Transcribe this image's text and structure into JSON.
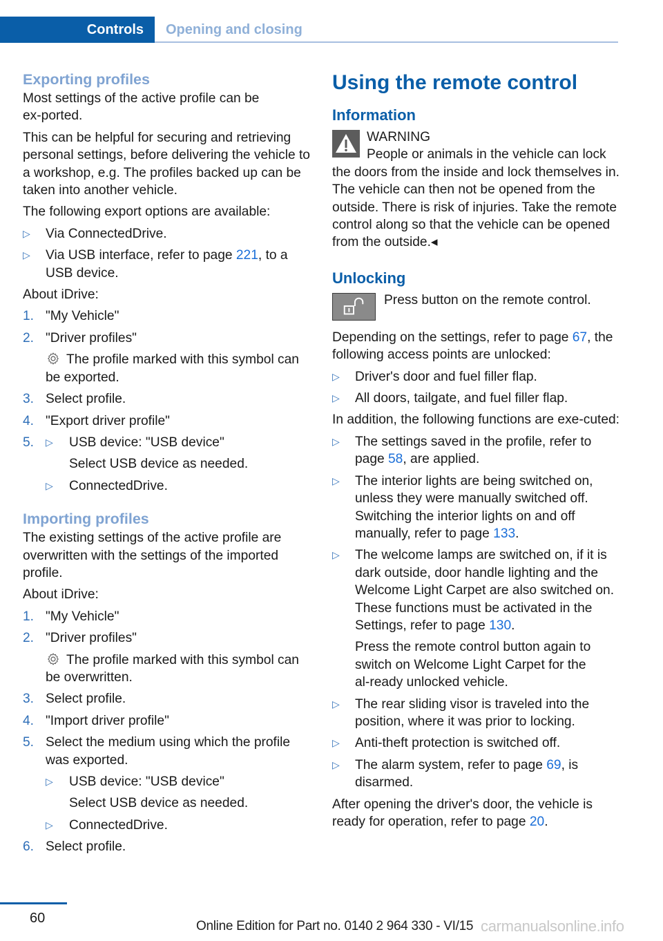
{
  "header": {
    "section": "Controls",
    "chapter": "Opening and closing"
  },
  "left": {
    "exporting": {
      "title": "Exporting profiles",
      "p1": "Most settings of the active profile can be ex‑ported.",
      "p2": "This can be helpful for securing and retrieving personal settings, before delivering the vehicle to a workshop, e.g. The profiles backed up can be taken into another vehicle.",
      "p3": "The following export options are available:",
      "options": [
        {
          "text": "Via ConnectedDrive."
        },
        {
          "pre": "Via USB interface, refer to page ",
          "link": "221",
          "post": ", to a USB device."
        }
      ],
      "about": "About iDrive:",
      "steps": [
        {
          "num": "1.",
          "text": "\"My Vehicle\""
        },
        {
          "num": "2.",
          "text": "\"Driver profiles\"",
          "note": "The profile marked with this symbol can be exported."
        },
        {
          "num": "3.",
          "text": "Select profile."
        },
        {
          "num": "4.",
          "text": "\"Export driver profile\""
        },
        {
          "num": "5.",
          "sub": [
            {
              "text": "USB device: \"USB device\"",
              "note": "Select USB device as needed."
            },
            {
              "text": "ConnectedDrive."
            }
          ]
        }
      ]
    },
    "importing": {
      "title": "Importing profiles",
      "p1": "The existing settings of the active profile are overwritten with the settings of the imported profile.",
      "about": "About iDrive:",
      "steps": [
        {
          "num": "1.",
          "text": "\"My Vehicle\""
        },
        {
          "num": "2.",
          "text": "\"Driver profiles\"",
          "note": "The profile marked with this symbol can be overwritten."
        },
        {
          "num": "3.",
          "text": "Select profile."
        },
        {
          "num": "4.",
          "text": "\"Import driver profile\""
        },
        {
          "num": "5.",
          "text": "Select the medium using which the profile was exported.",
          "sub": [
            {
              "text": "USB device: \"USB device\"",
              "note": "Select USB device as needed."
            },
            {
              "text": "ConnectedDrive."
            }
          ]
        },
        {
          "num": "6.",
          "text": "Select profile."
        }
      ]
    }
  },
  "right": {
    "title": "Using the remote control",
    "information": {
      "title": "Information",
      "warning_label": "WARNING",
      "warning_text": "People or animals in the vehicle can lock the doors from the inside and lock themselves in. The vehicle can then not be opened from the outside. There is risk of injuries. Take the remote control along so that the vehicle can be opened from the outside.",
      "end_mark": "◂"
    },
    "unlocking": {
      "title": "Unlocking",
      "press": "Press button on the remote control.",
      "p1_pre": "Depending on the settings, refer to page ",
      "p1_link": "67",
      "p1_post": ", the following access points are unlocked:",
      "access": [
        "Driver's door and fuel filler flap.",
        "All doors, tailgate, and fuel filler flap."
      ],
      "p2": "In addition, the following functions are exe‑cuted:",
      "functions": [
        {
          "pre": "The settings saved in the profile, refer to page ",
          "link": "58",
          "post": ", are applied."
        },
        {
          "pre": "The interior lights are being switched on, unless they were manually switched off. Switching the interior lights on and off manually, refer to page ",
          "link": "133",
          "post": "."
        },
        {
          "pre": "The welcome lamps are switched on, if it is dark outside, door handle lighting and the Welcome Light Carpet are also switched on. These functions must be activated in the Settings, refer to page ",
          "link": "130",
          "post": ".",
          "note": "Press the remote control button again to switch on Welcome Light Carpet for the al‑ready unlocked vehicle."
        },
        {
          "pre": "The rear sliding visor is traveled into the position, where it was prior to locking.",
          "link": "",
          "post": ""
        },
        {
          "pre": "Anti-theft protection is switched off.",
          "link": "",
          "post": ""
        },
        {
          "pre": "The alarm system, refer to page ",
          "link": "69",
          "post": ", is disarmed."
        }
      ],
      "p3_pre": "After opening the driver's door, the vehicle is ready for operation, refer to page ",
      "p3_link": "20",
      "p3_post": "."
    }
  },
  "footer": {
    "page": "60",
    "edition": "Online Edition for Part no. 0140 2 964 330 - VI/15",
    "watermark": "carmanualsonline.info"
  },
  "icons": {
    "bullet": "▷"
  },
  "colors": {
    "brand_blue": "#0a5ea8",
    "light_blue": "#7fa3d2",
    "link_blue": "#1a6ed8"
  }
}
